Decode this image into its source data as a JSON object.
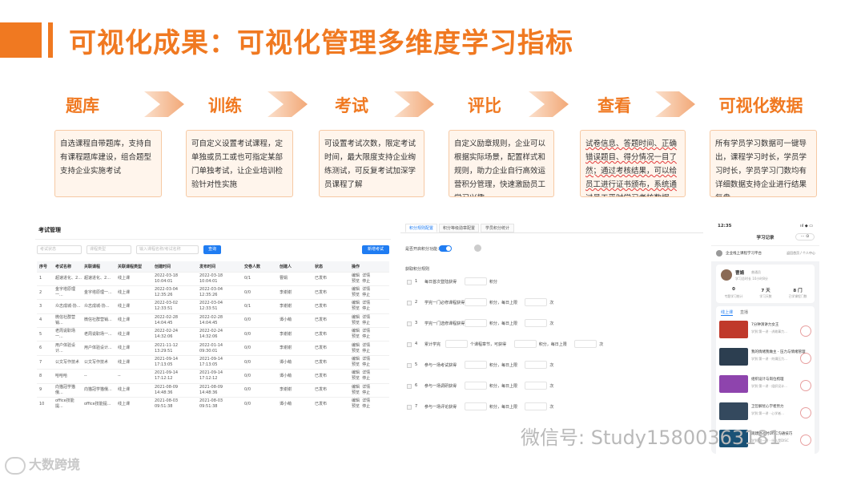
{
  "header": {
    "title": "可视化成果：可视化管理多维度学习指标"
  },
  "steps": [
    {
      "title": "题库",
      "desc": "自选课程自带题库，支持自有课程题库建设，组合题型支持企业实施考试"
    },
    {
      "title": "训练",
      "desc": "可自定义设置考试课程，定单独或员工或也可指定某部门单独考试，让企业培训检验针对性实施"
    },
    {
      "title": "考试",
      "desc": "可设置考试次数，限定考试时间，最大限度支持企业绚练测试，可反复考试加深学员课程了解"
    },
    {
      "title": "评比",
      "desc": "自定义励章规则，企业可以根据实际场景，配置样式和规则，助力企业自行高效运营积分管理，快速激励员工学习兴趣"
    },
    {
      "title": "查看",
      "desc": "试卷信息、答题时间、正确错误题目、得分情况一目了然；通过考核结果，可以给员工进行证书颁布，系统通过员工平时学习考核数据，进行人才预选拔"
    },
    {
      "title": "可视化数据",
      "desc": "所有学员学习数据可一键导出，课程学习时长，学员学习时长，学员学习门数均有详细数据支持企业进行结果复盘"
    }
  ],
  "exam_panel": {
    "title": "考试管理",
    "filters": [
      "考试状态",
      "课程类型",
      "输入课程名称/考试名称"
    ],
    "search_label": "查询",
    "new_label": "新增考试",
    "columns": [
      "序号",
      "考试名称",
      "关联课程",
      "关联课程类型",
      "创建时间",
      "发布时间",
      "交卷人数",
      "创建人",
      "状态",
      "操作"
    ],
    "rows": [
      [
        "1",
        "超速进化、2...",
        "超速进化、2...",
        "线上课",
        "2022-03-18 10:04:01",
        "2022-03-18 10:04:01",
        "0/1",
        "曹娟",
        "已发布",
        "编辑  详情\n预览  停止"
      ],
      [
        "2",
        "金字塔原理一...",
        "金字塔原理一...",
        "线上课",
        "2022-03-04 12:35:26",
        "2022-03-04 12:35:26",
        "0/0",
        "李谢谢",
        "已发布",
        "编辑  详情\n预览  停止"
      ],
      [
        "3",
        "众志成城-协...",
        "众志成城-协...",
        "线上课",
        "2022-03-02 12:33:51",
        "2022-03-04 12:33:51",
        "0/1",
        "李谢谢",
        "已发布",
        "编辑  详情\n预览  停止"
      ],
      [
        "4",
        "微信社群营销...",
        "微信社群营销...",
        "线上课",
        "2022-02-28 14:04:45",
        "2022-02-28 14:04:45",
        "0/0",
        "谭小萌",
        "已发布",
        "编辑  详情\n预览  停止"
      ],
      [
        "5",
        "老周说职场一...",
        "老周说职场一...",
        "线上课",
        "2022-02-24 14:32:06",
        "2022-02-24 14:32:06",
        "0/0",
        "李谢谢",
        "已发布",
        "编辑  详情\n预览  停止"
      ],
      [
        "6",
        "用户体验设计...",
        "用户体验设计...",
        "线上课",
        "2021-11-12 13:29:51",
        "2022-01-14 09:30:01",
        "0/0",
        "李谢谢",
        "已发布",
        "编辑  详情\n预览  停止"
      ],
      [
        "7",
        "公文写作技术",
        "公文写作技术",
        "线上课",
        "2021-09-14 17:13:05",
        "2021-09-14 17:13:05",
        "0/0",
        "谭小萌",
        "已发布",
        "编辑  详情\n预览  停止"
      ],
      [
        "8",
        "哈哈哈",
        "--",
        "--",
        "2021-09-14 17:12:12",
        "2021-09-14 17:12:12",
        "0/0",
        "谭小萌",
        "已发布",
        "编辑  详情\n预览  停止"
      ],
      [
        "9",
        "向猫冠学猫俄...",
        "向猫冠学猫俄...",
        "线上课",
        "2021-08-09 14:48:36",
        "2021-08-09 14:48:36",
        "0/0",
        "李谢谢",
        "已发布",
        "编辑  详情\n预览  停止"
      ],
      [
        "10",
        "office技能提...",
        "office技能提...",
        "线上课",
        "2021-08-03 09:51:38",
        "2021-08-03 09:51:38",
        "0/0",
        "谭小萌",
        "已发布",
        "编辑  详情\n预览  停止"
      ]
    ]
  },
  "points_panel": {
    "tabs": [
      "积分规则配置",
      "积分等级勋章配置",
      "学员积分统计"
    ],
    "enable_label": "是否开启积分功能：",
    "rules_label": "获取积分规则",
    "rules": [
      {
        "n": "1",
        "text": "每日首次登陆获得",
        "after": [
          "积分"
        ]
      },
      {
        "n": "2",
        "text": "学完一门必修课程获得",
        "after": [
          "积分，每日上限",
          "次"
        ]
      },
      {
        "n": "3",
        "text": "学完一门选修课程获得",
        "after": [
          "积分，每日上限",
          "次"
        ]
      },
      {
        "n": "4",
        "text": "累计学完",
        "after": [
          "个课程章节，可获得",
          "积分，每日上限",
          "次"
        ]
      },
      {
        "n": "5",
        "text": "参与一场考试获得",
        "after": [
          "积分，每日上限",
          "次"
        ]
      },
      {
        "n": "6",
        "text": "参与一场调研获得",
        "after": [
          "积分，每日上限",
          "次"
        ]
      },
      {
        "n": "7",
        "text": "参与一场评论获得",
        "after": [
          "积分，每日上限",
          "次"
        ]
      }
    ]
  },
  "phone": {
    "time": "12:35",
    "status": "ııl ◆ ▭",
    "title": "学习记录",
    "caps": "··· ⊙",
    "org": "企业线上课程学习平台",
    "org_right": "返回首页 / 个人中心",
    "user_name": "曹娟",
    "user_tag": "普通员",
    "user_sub": "学习总时长  10小时8分",
    "stats": [
      {
        "v": "0",
        "l": "专题学习统计"
      },
      {
        "v": "7 天",
        "l": "学习天数"
      },
      {
        "v": "8 门",
        "l": "已学课程门数"
      }
    ],
    "tabs": [
      "线上课",
      "直播"
    ],
    "items": [
      {
        "t": "7分钟演讲力女王",
        "s": "学到:第一讲 · 讲故事力..."
      },
      {
        "t": "我的情绪我做主 - 压力与情绪管理",
        "s": "学到:第一讲 · 何谓压力..."
      },
      {
        "t": "组织设计与岗位梳理",
        "s": "学到:第一讲 · 组织设计..."
      },
      {
        "t": "卫哲解忧心学者势力",
        "s": "学到:第一讲 · 心学者..."
      },
      {
        "t": "观建胜过时DISC沟通技巧",
        "s": "学到:第一讲 · 什么是DISC"
      }
    ]
  },
  "watermark": {
    "wechat": "微信号: Study15800363181",
    "logo": "大数跨境"
  },
  "colors": {
    "accent": "#f07921",
    "primary_blue": "#1f7cf2",
    "published_green": "#17a54a"
  }
}
